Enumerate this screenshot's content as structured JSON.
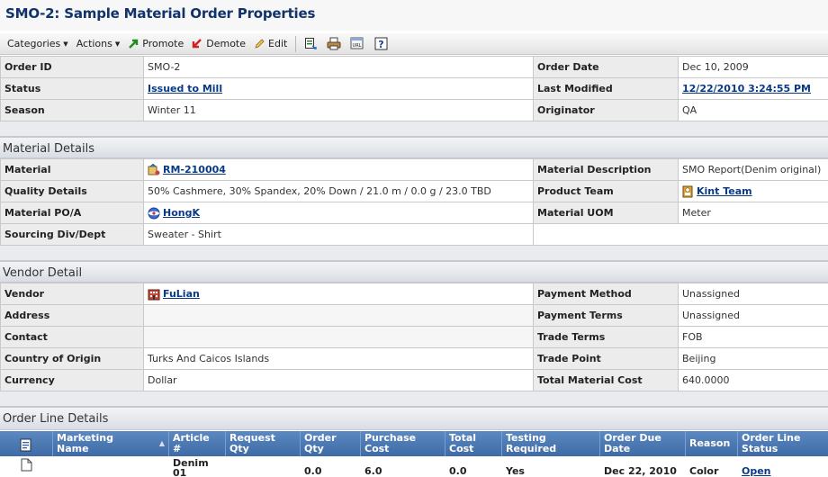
{
  "page_title": "SMO-2: Sample Material Order Properties",
  "toolbar": {
    "categories": "Categories",
    "actions": "Actions",
    "promote": "Promote",
    "demote": "Demote",
    "edit": "Edit"
  },
  "header_fields": {
    "order_id_label": "Order ID",
    "order_id": "SMO-2",
    "order_date_label": "Order Date",
    "order_date": "Dec 10, 2009",
    "status_label": "Status",
    "status": "Issued to Mill",
    "last_modified_label": "Last Modified",
    "last_modified": "12/22/2010 3:24:55 PM",
    "season_label": "Season",
    "season": "Winter 11",
    "originator_label": "Originator",
    "originator": "QA"
  },
  "material_details": {
    "section_title": "Material Details",
    "material_label": "Material",
    "material": "RM-210004",
    "material_description_label": "Material Description",
    "material_description": "SMO Report(Denim original)",
    "quality_details_label": "Quality Details",
    "quality_details": "50% Cashmere, 30% Spandex, 20% Down / 21.0 m / 0.0 g / 23.0 TBD",
    "product_team_label": "Product Team",
    "product_team": "Kint Team",
    "material_po_label": "Material PO/A",
    "material_po": "HongK",
    "material_uom_label": "Material UOM",
    "material_uom": "Meter",
    "sourcing_label": "Sourcing Div/Dept",
    "sourcing": "Sweater - Shirt"
  },
  "vendor_detail": {
    "section_title": "Vendor Detail",
    "vendor_label": "Vendor",
    "vendor": "FuLian",
    "payment_method_label": "Payment Method",
    "payment_method": "Unassigned",
    "address_label": "Address",
    "payment_terms_label": "Payment Terms",
    "payment_terms": "Unassigned",
    "contact_label": "Contact",
    "trade_terms_label": "Trade Terms",
    "trade_terms": "FOB",
    "country_label": "Country of Origin",
    "country": "Turks And Caicos Islands",
    "trade_point_label": "Trade Point",
    "trade_point": "Beijing",
    "currency_label": "Currency",
    "currency": "Dollar",
    "total_cost_label": "Total Material Cost",
    "total_cost": "640.0000"
  },
  "order_lines": {
    "section_title": "Order Line Details",
    "columns": {
      "marketing_name": [
        "Marketing",
        "Name"
      ],
      "article": [
        "Article",
        "#"
      ],
      "request_qty": [
        "Request",
        "Qty"
      ],
      "order_qty": [
        "Order",
        "Qty"
      ],
      "purchase_cost": [
        "Purchase",
        "Cost"
      ],
      "total_cost": [
        "Total",
        "Cost"
      ],
      "testing_required": [
        "Testing",
        "Required"
      ],
      "order_due_date": [
        "Order Due",
        "Date"
      ],
      "reason": [
        "Reason"
      ],
      "order_line_status": [
        "Order Line",
        "Status"
      ]
    },
    "rows": [
      {
        "article": [
          "Denim",
          "01"
        ],
        "order_qty": "0.0",
        "purchase_cost": "6.0",
        "total_cost": "0.0",
        "testing_required": "Yes",
        "order_due_date": "Dec 22, 2010",
        "reason": "Color",
        "order_line_status": "Open"
      }
    ]
  }
}
